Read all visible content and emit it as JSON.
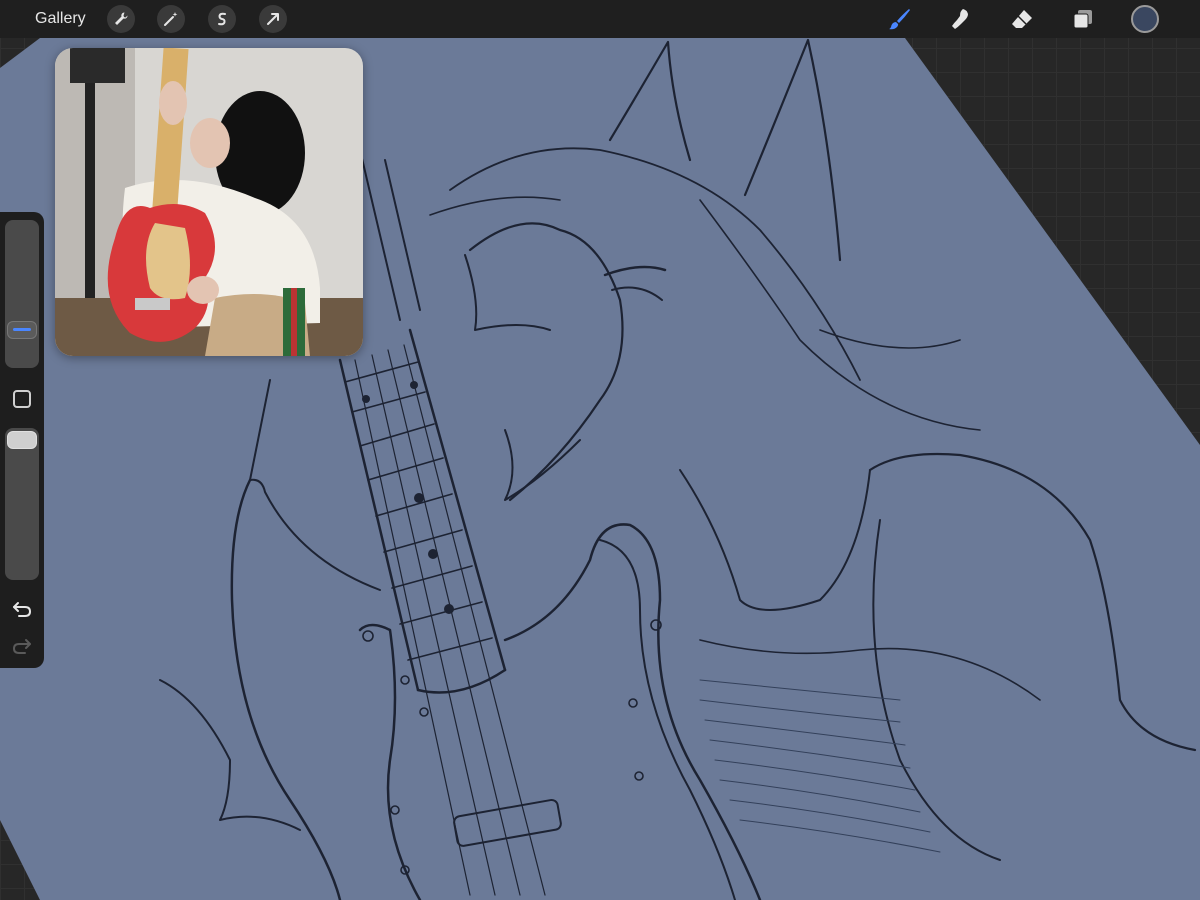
{
  "app": {
    "gallery_label": "Gallery"
  },
  "toolbar": {
    "left_tools": [
      {
        "icon": "wrench-icon"
      },
      {
        "icon": "magic-wand-icon"
      },
      {
        "icon": "selection-s-icon"
      },
      {
        "icon": "arrow-transform-icon"
      }
    ],
    "right_tools": [
      {
        "icon": "brush-icon",
        "active": true
      },
      {
        "icon": "smudge-icon"
      },
      {
        "icon": "eraser-icon"
      },
      {
        "icon": "layers-icon"
      }
    ],
    "current_color": "#3a4760",
    "accent_color": "#4a86ff"
  },
  "sidebar": {
    "brush_size": 0.21,
    "brush_opacity": 1.0
  },
  "canvas": {
    "background_color": "#6b7a98"
  }
}
